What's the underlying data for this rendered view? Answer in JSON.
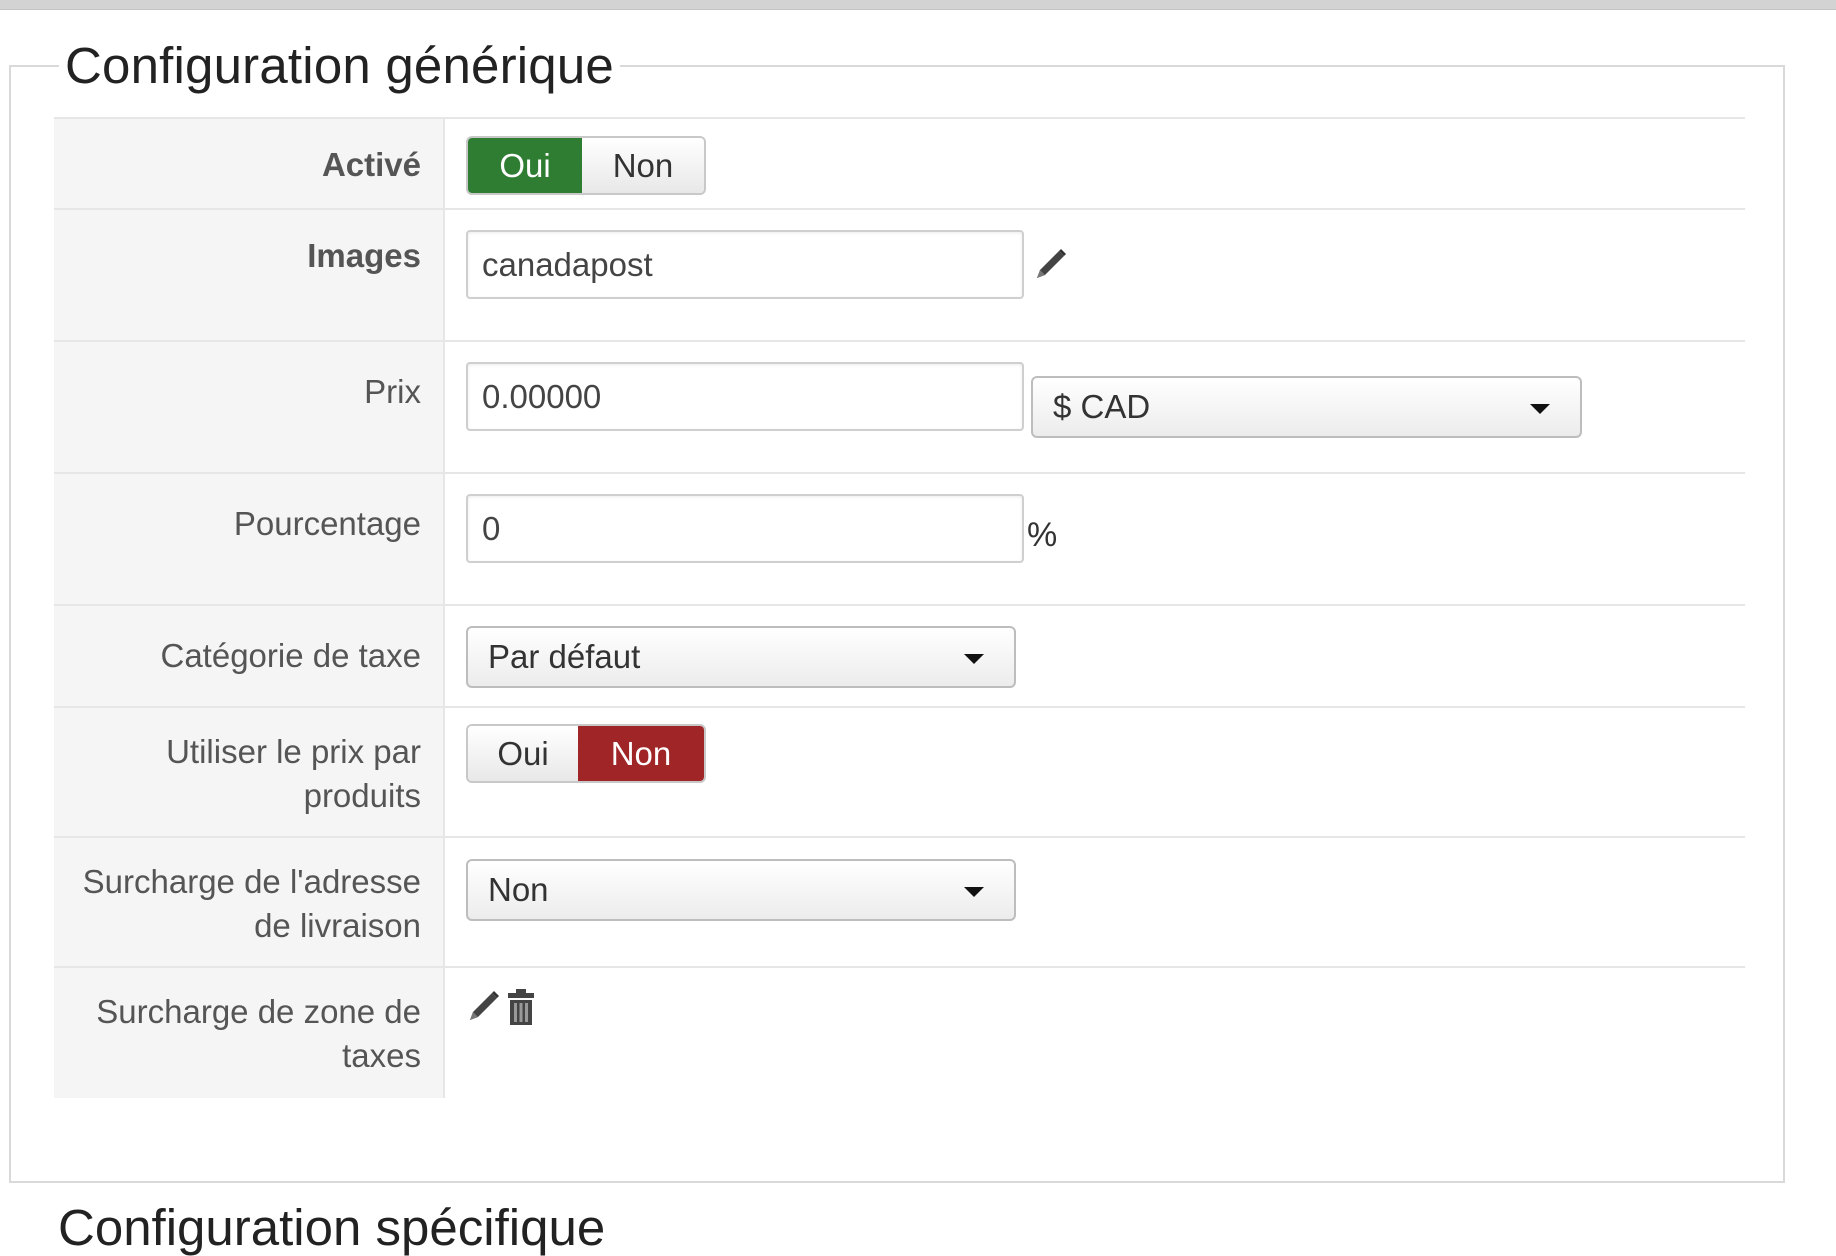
{
  "section": {
    "title": "Configuration générique"
  },
  "next_section": {
    "title": "Configuration spécifique"
  },
  "rows": {
    "active": {
      "label": "Activé",
      "yes": "Oui",
      "no": "Non",
      "selected": "Oui"
    },
    "images": {
      "label": "Images",
      "value": "canadapost",
      "icon": "pencil-icon"
    },
    "price": {
      "label": "Prix",
      "value": "0.00000",
      "currency": "$ CAD"
    },
    "percentage": {
      "label": "Pourcentage",
      "value": "0",
      "suffix": "%"
    },
    "tax_category": {
      "label": "Catégorie de taxe",
      "value": "Par défaut"
    },
    "use_product_price": {
      "label_line1": "Utiliser le prix par",
      "label_line2": "produits",
      "yes": "Oui",
      "no": "Non",
      "selected": "Non"
    },
    "shipping_address_override": {
      "label_line1": "Surcharge de l'adresse",
      "label_line2": "de livraison",
      "value": "Non"
    },
    "tax_zone_override": {
      "label_line1": "Surcharge de zone de",
      "label_line2": "taxes",
      "icons": [
        "pencil-icon",
        "trash-icon"
      ]
    }
  },
  "colors": {
    "active_green": "#2f7d32",
    "inactive_red": "#a02527"
  }
}
